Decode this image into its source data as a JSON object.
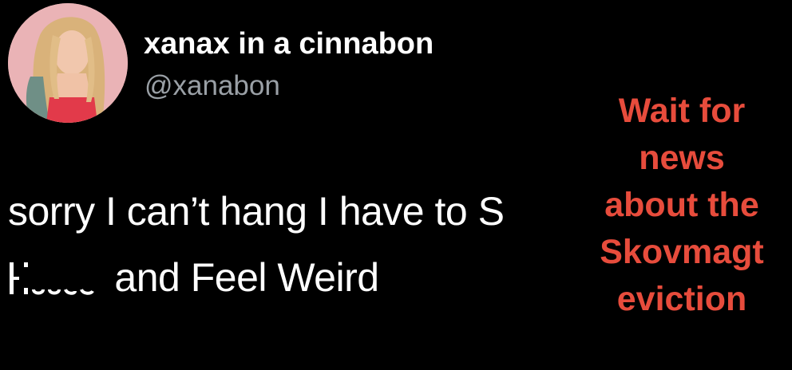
{
  "tweet": {
    "display_name": "xanax in a cinnabon",
    "handle": "@xanabon",
    "text_line_1": "sorry I can’t hang I have to S",
    "text_line_2_end": "and Feel Weird"
  },
  "overlay": {
    "lines": [
      "Wait for",
      "news",
      "about the",
      "Skovmagt",
      "eviction"
    ],
    "color": "#e74c3c"
  }
}
